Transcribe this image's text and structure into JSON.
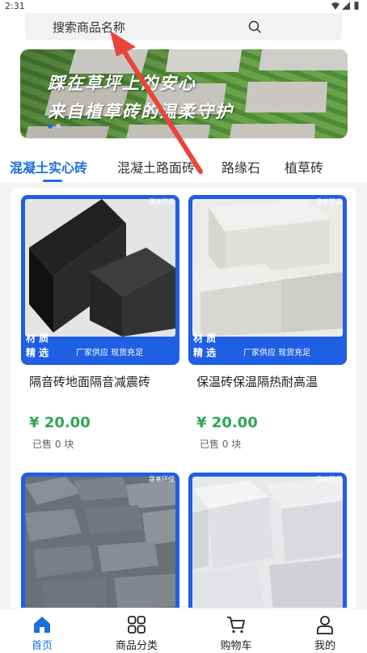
{
  "status_bar": {
    "time": "2:31"
  },
  "search": {
    "placeholder": "搜索商品名称"
  },
  "banner": {
    "line1": "踩在草坪上的安心",
    "line2": "来自植草砖的温柔守护"
  },
  "tabs": [
    {
      "label": "混凝土实心砖",
      "active": true
    },
    {
      "label": "混凝土路面砖",
      "active": false
    },
    {
      "label": "路缘石",
      "active": false
    },
    {
      "label": "植草砖",
      "active": false
    }
  ],
  "products": [
    {
      "brand_tag": "晟基环保",
      "quality_tag_line1": "材 质",
      "quality_tag_line2": "精 选",
      "supply_tag": "厂家供应  现货充足",
      "title": "隔音砖地面隔音减震砖",
      "price": "¥ 20.00",
      "sold": "已售 0 块"
    },
    {
      "brand_tag": "晟基环保",
      "quality_tag_line1": "材 质",
      "quality_tag_line2": "精 选",
      "supply_tag": "厂家供应  现货充足",
      "title": "保温砖保温隔热耐高温",
      "price": "¥ 20.00",
      "sold": "已售 0 块"
    },
    {
      "brand_tag": "晟基环保"
    },
    {
      "brand_tag": "晟基环保"
    }
  ],
  "bottom_nav": [
    {
      "label": "首页",
      "icon": "home-icon",
      "active": true
    },
    {
      "label": "商品分类",
      "icon": "category-icon",
      "active": false
    },
    {
      "label": "购物车",
      "icon": "cart-icon",
      "active": false
    },
    {
      "label": "我的",
      "icon": "user-icon",
      "active": false
    }
  ],
  "colors": {
    "accent": "#1b6fde",
    "price": "#2fa84f",
    "annotation_arrow": "#e8453c"
  }
}
